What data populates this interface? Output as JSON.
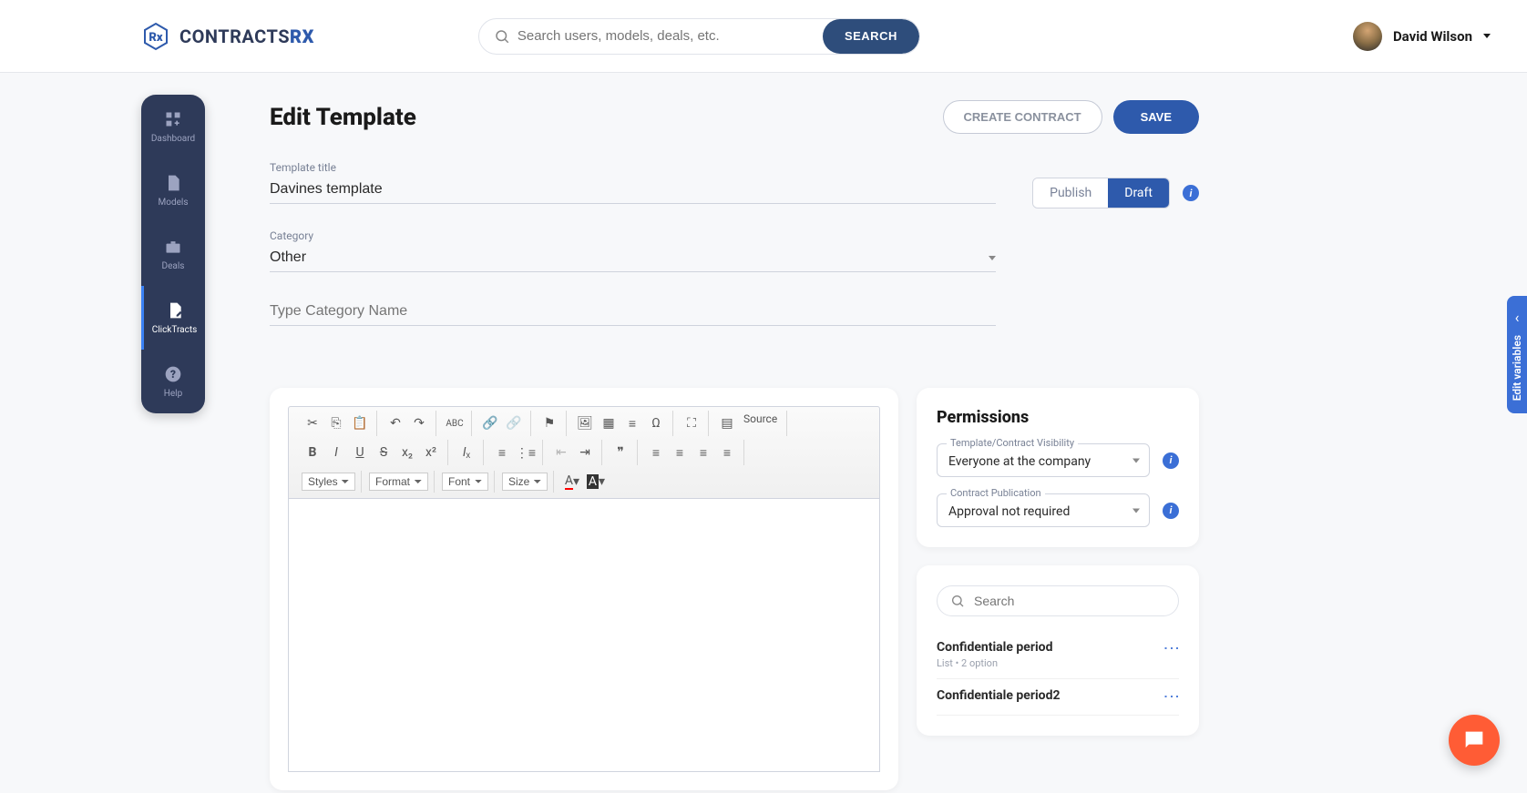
{
  "header": {
    "logo_text": "CONTRACTS",
    "logo_suffix": "RX",
    "search_placeholder": "Search users, models, deals, etc.",
    "search_button": "SEARCH",
    "user_name": "David Wilson"
  },
  "sidebar": {
    "items": [
      {
        "label": "Dashboard",
        "icon": "dashboard"
      },
      {
        "label": "Models",
        "icon": "document"
      },
      {
        "label": "Deals",
        "icon": "briefcase"
      },
      {
        "label": "ClickTracts",
        "icon": "document-edit",
        "active": true
      },
      {
        "label": "Help",
        "icon": "help"
      }
    ]
  },
  "page": {
    "title": "Edit Template",
    "create_contract": "CREATE CONTRACT",
    "save": "SAVE"
  },
  "form": {
    "title_label": "Template title",
    "title_value": "Davines template",
    "category_label": "Category",
    "category_value": "Other",
    "category_name_placeholder": "Type Category Name",
    "publish_toggle": {
      "publish": "Publish",
      "draft": "Draft",
      "active": "draft"
    }
  },
  "editor": {
    "source_label": "Source",
    "dropdowns": {
      "styles": "Styles",
      "format": "Format",
      "font": "Font",
      "size": "Size"
    }
  },
  "permissions": {
    "title": "Permissions",
    "visibility_label": "Template/Contract Visibility",
    "visibility_value": "Everyone at the company",
    "publication_label": "Contract Publication",
    "publication_value": "Approval not required"
  },
  "variables": {
    "search_placeholder": "Search",
    "items": [
      {
        "name": "Confidentiale period",
        "meta": "List • 2 option"
      },
      {
        "name": "Confidentiale period2",
        "meta": ""
      }
    ]
  },
  "side_tab": "Edit variables"
}
